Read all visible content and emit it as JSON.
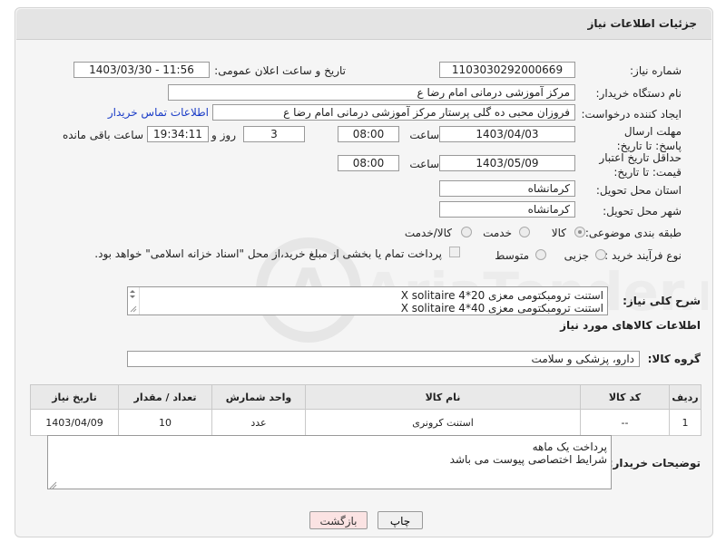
{
  "header": {
    "title": "جزئیات اطلاعات نیاز"
  },
  "form": {
    "need_number": {
      "label": "شماره نیاز:",
      "value": "1103030292000669"
    },
    "announce": {
      "label": "تاریخ و ساعت اعلان عمومی:",
      "value": "1403/03/30 - 11:56"
    },
    "buyer_org": {
      "label": "نام دستگاه خریدار:",
      "value": "مرکز آموزشی  درمانی امام رضا  ع"
    },
    "creator": {
      "label": "ایجاد کننده درخواست:",
      "value": "فروزان محبی ده گلی پرستار مرکز آموزشی  درمانی امام رضا  ع",
      "contact_link": "اطلاعات تماس خریدار"
    },
    "reply_deadline": {
      "label": "مهلت ارسال پاسخ: تا تاریخ:",
      "date": "1403/04/03",
      "time_label": "ساعت",
      "time": "08:00",
      "days": "3",
      "days_label": "روز و",
      "remaining": "19:34:11",
      "remaining_label": "ساعت باقی مانده"
    },
    "price_deadline": {
      "label": "حداقل تاریخ اعتبار قیمت: تا تاریخ:",
      "date": "1403/05/09",
      "time_label": "ساعت",
      "time": "08:00"
    },
    "province": {
      "label": "استان محل تحویل:",
      "value": "کرمانشاه"
    },
    "city": {
      "label": "شهر محل تحویل:",
      "value": "کرمانشاه"
    },
    "category": {
      "label": "طبقه بندی موضوعی:",
      "options": [
        "کالا",
        "خدمت",
        "کالا/خدمت"
      ]
    },
    "process": {
      "label": "نوع فرآیند خرید :",
      "options": [
        "جزیی",
        "متوسط"
      ],
      "payment_note": "پرداخت تمام یا بخشی از مبلغ خرید،از محل \"اسناد خزانه اسلامی\" خواهد بود."
    },
    "summary": {
      "label": "شرح کلی نیاز:",
      "lines": [
        "استنت ترومبکتومی    معزی     20*4   X  solitaire",
        "استنت ترومبکتومی    معزی     40*4   X  solitaire"
      ]
    }
  },
  "goods": {
    "section_title": "اطلاعات کالاهای مورد نیاز",
    "group_label": "گروه کالا:",
    "group_value": "دارو، پزشکی و سلامت",
    "columns": [
      "ردیف",
      "کد کالا",
      "نام کالا",
      "واحد شمارش",
      "تعداد / مقدار",
      "تاریخ نیاز"
    ],
    "rows": [
      {
        "idx": "1",
        "code": "--",
        "name": "استنت کرونری",
        "unit": "عدد",
        "qty": "10",
        "date": "1403/04/09"
      }
    ]
  },
  "buyer_notes": {
    "label": "توضیحات خریدار:",
    "lines": [
      "پرداخت   یک ماهه",
      "شرایط   اختصاصی پیوست می باشد"
    ]
  },
  "buttons": {
    "print": "چاپ",
    "back": "بازگشت"
  },
  "watermark": {
    "text": "AriaTender.net"
  }
}
